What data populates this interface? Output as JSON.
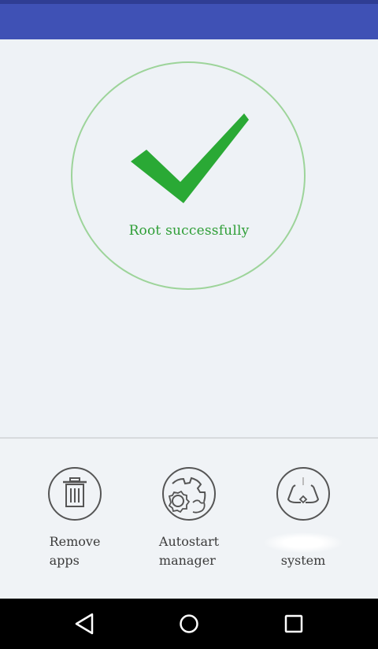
{
  "status": {
    "message": "Root successfully",
    "icon": "checkmark-icon",
    "accent_color": "#2e9e36",
    "ring_color": "#9dd49a"
  },
  "app_bar": {
    "color": "#3f51b5"
  },
  "tools": [
    {
      "label": "Remove\napps",
      "icon": "trash-icon"
    },
    {
      "label": "Autostart\nmanager",
      "icon": "gears-icon"
    },
    {
      "label": "system",
      "icon": "recycle-icon"
    }
  ],
  "nav": {
    "back_icon": "back-triangle-icon",
    "home_icon": "home-circle-icon",
    "recents_icon": "recents-square-icon"
  }
}
